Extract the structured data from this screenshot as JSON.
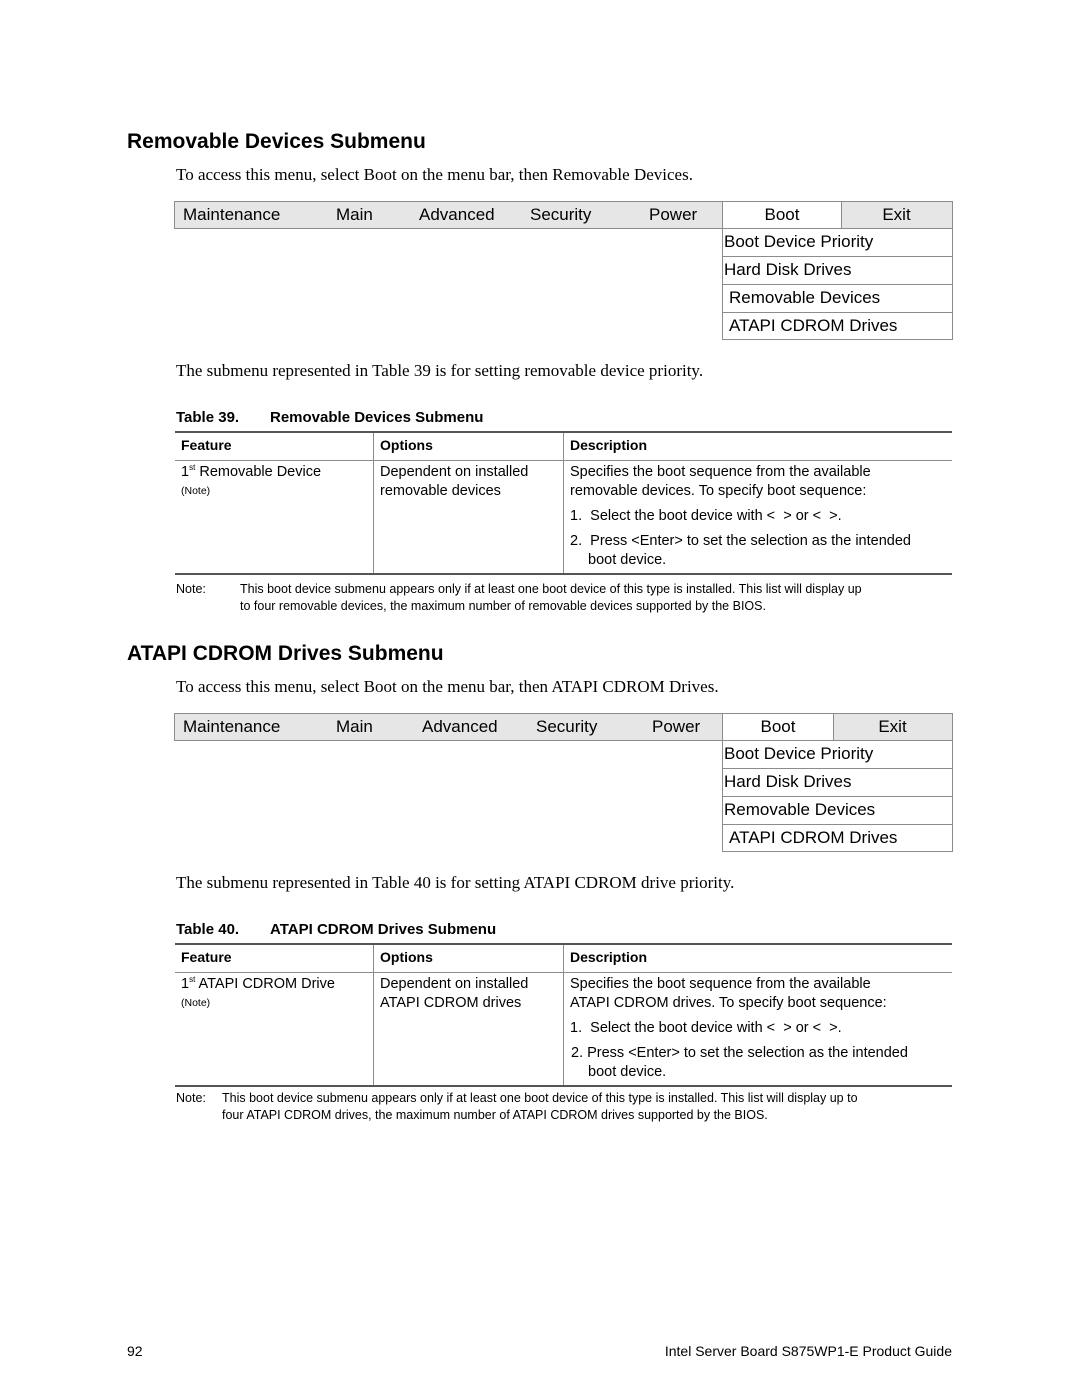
{
  "section1": {
    "heading": "Removable Devices Submenu",
    "intro": "To access this menu, select Boot on the menu bar, then Removable Devices.",
    "menu_bar": [
      "Maintenance",
      "Main",
      "Advanced",
      "Security",
      "Power",
      "Boot",
      "Exit"
    ],
    "selected_menu": "Boot",
    "submenu_items": [
      "Boot Device Priority",
      "Hard Disk Drives",
      "Removable Devices",
      "ATAPI CDROM Drives"
    ],
    "after_text": "The submenu represented in Table 39 is for setting removable device priority.",
    "table": {
      "number": "Table 39.",
      "title": "Removable Devices Submenu",
      "columns": [
        "Feature",
        "Options",
        "Description"
      ],
      "row": {
        "feature_ordinal": "1",
        "feature_sup": "st",
        "feature": " Removable Device",
        "feature_note": "(Note)",
        "options": [
          "Dependent on installed",
          "removable devices"
        ],
        "description": [
          "Specifies the boot sequence from the available",
          "removable devices. To specify boot sequence:"
        ],
        "steps": [
          "1.  Select the boot device with <  > or <  >.",
          "2.  Press <Enter> to set the selection as the intended",
          "boot device."
        ]
      }
    },
    "note_label": "Note:",
    "note_lines": [
      "This boot device submenu appears only if at least one boot device of this type is installed. This list will display up",
      "to four removable devices, the maximum number of removable devices supported by the BIOS."
    ]
  },
  "section2": {
    "heading": "ATAPI CDROM Drives Submenu",
    "intro": "To access this menu, select Boot on the menu bar, then ATAPI CDROM Drives.",
    "menu_bar": [
      "Maintenance",
      "Main",
      "Advanced",
      "Security",
      "Power",
      "Boot",
      "Exit"
    ],
    "selected_menu": "Boot",
    "submenu_items": [
      "Boot Device Priority",
      "Hard Disk Drives",
      "Removable Devices",
      "ATAPI CDROM Drives"
    ],
    "after_text": "The submenu represented in Table 40 is for setting ATAPI CDROM drive priority.",
    "table": {
      "number": "Table 40.",
      "title": "ATAPI CDROM Drives Submenu",
      "columns": [
        "Feature",
        "Options",
        "Description"
      ],
      "row": {
        "feature_ordinal": "1",
        "feature_sup": "st",
        "feature": " ATAPI CDROM Drive",
        "feature_note": "(Note)",
        "options": [
          "Dependent on installed",
          "ATAPI CDROM drives"
        ],
        "description": [
          "Specifies the boot sequence from the available",
          "ATAPI CDROM drives. To specify boot sequence:"
        ],
        "steps": [
          "1.  Select the boot device with <  > or <  >.",
          "2. Press <Enter> to set the selection as the intended",
          "boot device."
        ]
      }
    },
    "note_label": "Note:",
    "note_lines": [
      "This boot device submenu appears only if at least one boot device of this type is installed. This list will display up to",
      "four ATAPI CDROM drives, the maximum number of ATAPI CDROM drives supported by the BIOS."
    ]
  },
  "footer": {
    "page_number": "92",
    "doc_title": "Intel Server Board S875WP1-E Product Guide"
  }
}
